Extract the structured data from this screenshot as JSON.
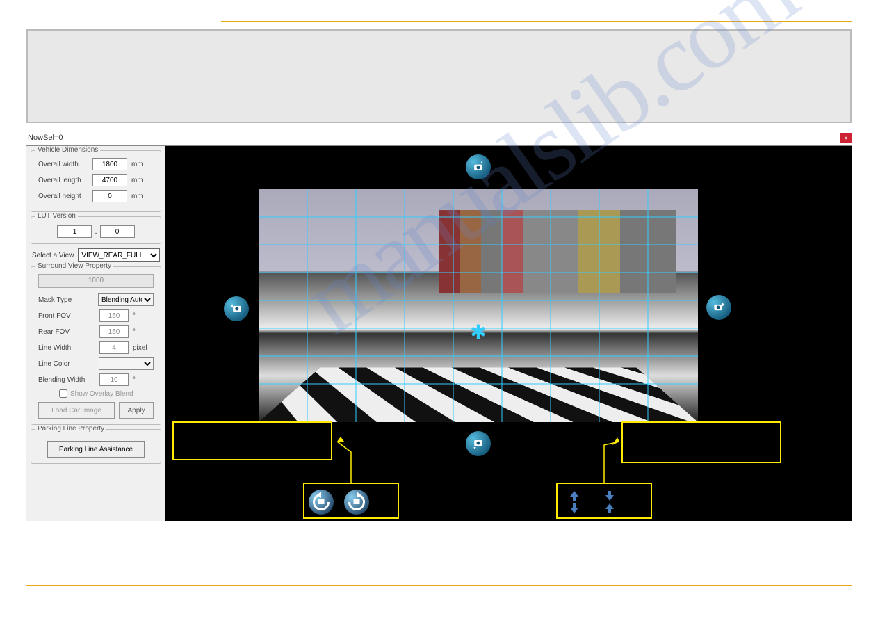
{
  "status": {
    "text": "NowSel=0"
  },
  "vehicle": {
    "legend": "Vehicle Dimensions",
    "width_label": "Overall width",
    "width_value": "1800",
    "length_label": "Overall length",
    "length_value": "4700",
    "height_label": "Overall height",
    "height_value": "0",
    "unit": "mm"
  },
  "lut": {
    "legend": "LUT Version",
    "major": "1",
    "minor": "0"
  },
  "view": {
    "label": "Select a View",
    "selected": "VIEW_REAR_FULL"
  },
  "svp": {
    "legend": "Surround View Property",
    "slider_value": "1000",
    "mask_label": "Mask Type",
    "mask_value": "Blending Auto",
    "ffov_label": "Front FOV",
    "ffov_value": "150",
    "rfov_label": "Rear FOV",
    "rfov_value": "150",
    "deg": "°",
    "lw_label": "Line Width",
    "lw_value": "4",
    "px": "pixel",
    "lc_label": "Line Color",
    "bw_label": "Blending Width",
    "bw_value": "10",
    "chk_label": "Show Overlay Blend",
    "load_btn": "Load Car Image",
    "apply_btn": "Apply"
  },
  "parking": {
    "legend": "Parking Line Property",
    "btn": "Parking Line Assistance"
  }
}
